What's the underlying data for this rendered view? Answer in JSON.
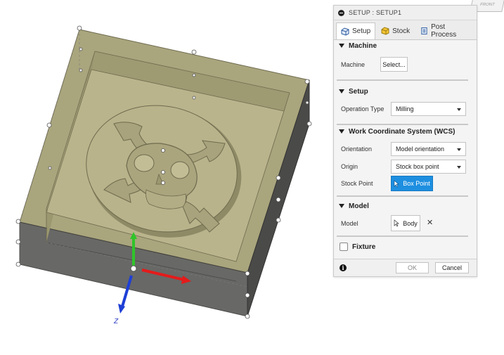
{
  "viewcube": {
    "face_label": "FRONT"
  },
  "axes": {
    "z_label": "Z",
    "x_color": "#e41b1b",
    "y_color": "#2fc42a",
    "z_color": "#1e3fd6"
  },
  "dialog": {
    "title": "SETUP : SETUP1",
    "tabs": [
      {
        "label": "Setup",
        "icon": "setup-icon",
        "active": true
      },
      {
        "label": "Stock",
        "icon": "stock-icon",
        "active": false
      },
      {
        "label": "Post Process",
        "icon": "post-process-icon",
        "active": false
      }
    ],
    "machine": {
      "header": "Machine",
      "label": "Machine",
      "button": "Select..."
    },
    "setup": {
      "header": "Setup",
      "operation_type_label": "Operation Type",
      "operation_type_value": "Milling"
    },
    "wcs": {
      "header": "Work Coordinate System (WCS)",
      "orientation_label": "Orientation",
      "orientation_value": "Model orientation",
      "origin_label": "Origin",
      "origin_value": "Stock box point",
      "stock_point_label": "Stock Point",
      "stock_point_button": "Box Point"
    },
    "model": {
      "header": "Model",
      "label": "Model",
      "button": "Body"
    },
    "fixture": {
      "label": "Fixture"
    },
    "footer": {
      "ok": "OK",
      "cancel": "Cancel"
    }
  },
  "colors": {
    "accent": "#1e8fe0",
    "body_top": "#aca87f",
    "body_side": "#6d6d6a",
    "cavity": "#b8b28c"
  }
}
